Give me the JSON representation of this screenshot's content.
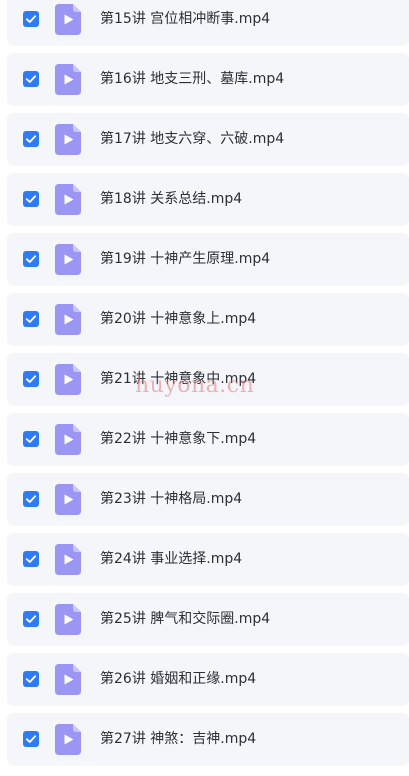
{
  "colors": {
    "row_background": "#f5f6fa",
    "checkbox": "#2f7bf5",
    "video_icon": "#9b95f3",
    "text": "#2b2f36",
    "watermark": "#e27878"
  },
  "files": [
    {
      "name": "第15讲 宫位相冲断事.mp4",
      "checked": true,
      "icon": "video-file-icon"
    },
    {
      "name": "第16讲 地支三刑、墓库.mp4",
      "checked": true,
      "icon": "video-file-icon"
    },
    {
      "name": "第17讲 地支六穿、六破.mp4",
      "checked": true,
      "icon": "video-file-icon"
    },
    {
      "name": "第18讲 关系总结.mp4",
      "checked": true,
      "icon": "video-file-icon"
    },
    {
      "name": "第19讲 十神产生原理.mp4",
      "checked": true,
      "icon": "video-file-icon"
    },
    {
      "name": "第20讲 十神意象上.mp4",
      "checked": true,
      "icon": "video-file-icon"
    },
    {
      "name": "第21讲 十神意象中.mp4",
      "checked": true,
      "icon": "video-file-icon"
    },
    {
      "name": "第22讲 十神意象下.mp4",
      "checked": true,
      "icon": "video-file-icon"
    },
    {
      "name": "第23讲 十神格局.mp4",
      "checked": true,
      "icon": "video-file-icon"
    },
    {
      "name": "第24讲 事业选择.mp4",
      "checked": true,
      "icon": "video-file-icon"
    },
    {
      "name": "第25讲 脾气和交际圈.mp4",
      "checked": true,
      "icon": "video-file-icon"
    },
    {
      "name": "第26讲 婚姻和正缘.mp4",
      "checked": true,
      "icon": "video-file-icon"
    },
    {
      "name": "第27讲 神煞：吉神.mp4",
      "checked": true,
      "icon": "video-file-icon"
    }
  ],
  "watermark": "huyona.cn"
}
